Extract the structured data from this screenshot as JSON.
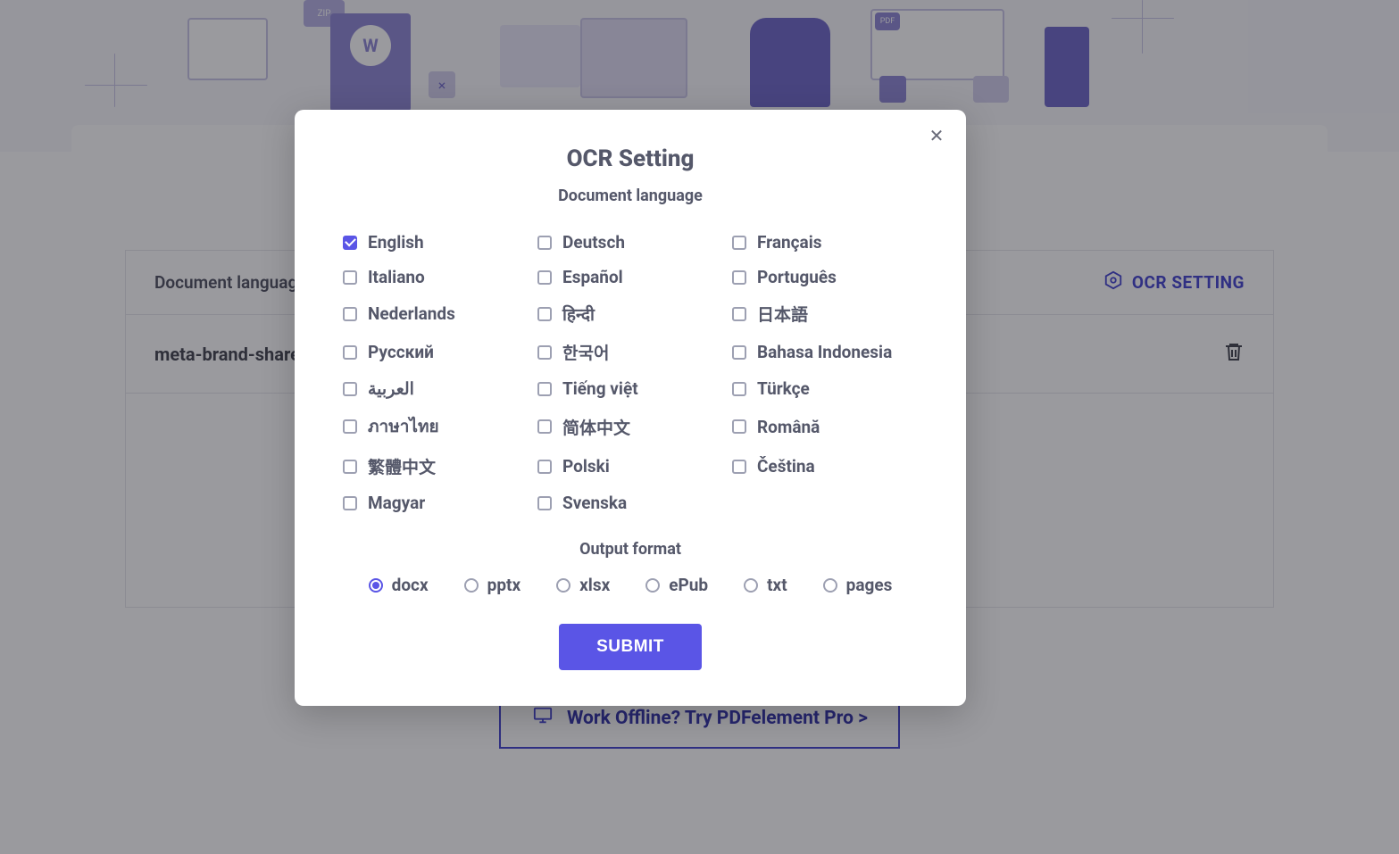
{
  "hero": {
    "zip_label": "ZIP",
    "w_label": "W",
    "x_label": "×",
    "pdf_label": "PDF"
  },
  "panel": {
    "doc_language_label": "Document language",
    "ocr_setting_label": "OCR SETTING",
    "filename": "meta-brand-share.j",
    "offline_button": "Work Offline? Try PDFelement Pro >"
  },
  "modal": {
    "title": "OCR Setting",
    "subtitle": "Document language",
    "languages": [
      {
        "label": "English",
        "checked": true
      },
      {
        "label": "Deutsch",
        "checked": false
      },
      {
        "label": "Français",
        "checked": false
      },
      {
        "label": "Italiano",
        "checked": false
      },
      {
        "label": "Español",
        "checked": false
      },
      {
        "label": "Português",
        "checked": false
      },
      {
        "label": "Nederlands",
        "checked": false
      },
      {
        "label": "हिन्दी",
        "checked": false
      },
      {
        "label": "日本語",
        "checked": false
      },
      {
        "label": "Русский",
        "checked": false
      },
      {
        "label": "한국어",
        "checked": false
      },
      {
        "label": "Bahasa Indonesia",
        "checked": false
      },
      {
        "label": "العربية",
        "checked": false
      },
      {
        "label": "Tiếng việt",
        "checked": false
      },
      {
        "label": "Türkçe",
        "checked": false
      },
      {
        "label": "ภาษาไทย",
        "checked": false
      },
      {
        "label": "简体中文",
        "checked": false
      },
      {
        "label": "Română",
        "checked": false
      },
      {
        "label": "繁體中文",
        "checked": false
      },
      {
        "label": "Polski",
        "checked": false
      },
      {
        "label": "Čeština",
        "checked": false
      },
      {
        "label": "Magyar",
        "checked": false
      },
      {
        "label": "Svenska",
        "checked": false
      }
    ],
    "output_title": "Output format",
    "formats": [
      {
        "label": "docx",
        "checked": true
      },
      {
        "label": "pptx",
        "checked": false
      },
      {
        "label": "xlsx",
        "checked": false
      },
      {
        "label": "ePub",
        "checked": false
      },
      {
        "label": "txt",
        "checked": false
      },
      {
        "label": "pages",
        "checked": false
      }
    ],
    "submit_label": "SUBMIT"
  }
}
